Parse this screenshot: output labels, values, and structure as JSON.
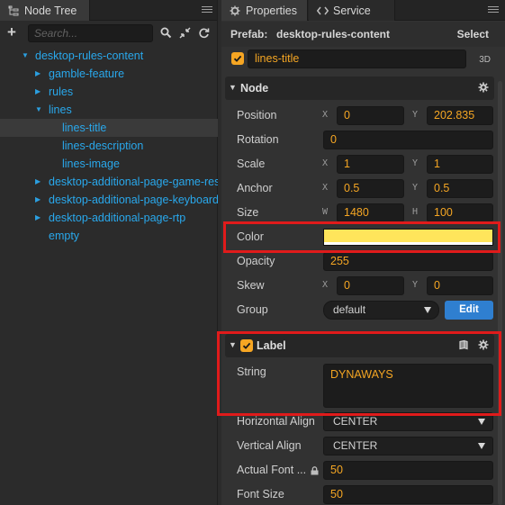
{
  "node_tree": {
    "tab_title": "Node Tree",
    "tab_icon": "tree-icon",
    "search_placeholder": "Search...",
    "nodes": [
      {
        "label": "desktop-rules-content",
        "depth": 0,
        "expanded": true,
        "has_children": true
      },
      {
        "label": "gamble-feature",
        "depth": 1,
        "expanded": false,
        "has_children": true
      },
      {
        "label": "rules",
        "depth": 1,
        "expanded": false,
        "has_children": true
      },
      {
        "label": "lines",
        "depth": 1,
        "expanded": true,
        "has_children": true
      },
      {
        "label": "lines-title",
        "depth": 2,
        "expanded": false,
        "has_children": false,
        "selected": true
      },
      {
        "label": "lines-description",
        "depth": 2,
        "expanded": false,
        "has_children": false
      },
      {
        "label": "lines-image",
        "depth": 2,
        "expanded": false,
        "has_children": false
      },
      {
        "label": "desktop-additional-page-game-resu",
        "depth": 1,
        "expanded": false,
        "has_children": true
      },
      {
        "label": "desktop-additional-page-keyboard",
        "depth": 1,
        "expanded": false,
        "has_children": true
      },
      {
        "label": "desktop-additional-page-rtp",
        "depth": 1,
        "expanded": false,
        "has_children": true
      },
      {
        "label": "empty",
        "depth": 1,
        "expanded": false,
        "has_children": false
      }
    ]
  },
  "properties": {
    "tab_title": "Properties",
    "service_tab": "Service",
    "prefab_label": "Prefab:",
    "prefab_name": "desktop-rules-content",
    "select_label": "Select",
    "node_name": "lines-title",
    "badge_3d": "3D",
    "node_section": {
      "title": "Node",
      "position": {
        "label": "Position",
        "x_axis": "X",
        "x": "0",
        "y_axis": "Y",
        "y": "202.835"
      },
      "rotation": {
        "label": "Rotation",
        "value": "0"
      },
      "scale": {
        "label": "Scale",
        "x_axis": "X",
        "x": "1",
        "y_axis": "Y",
        "y": "1"
      },
      "anchor": {
        "label": "Anchor",
        "x_axis": "X",
        "x": "0.5",
        "y_axis": "Y",
        "y": "0.5"
      },
      "size": {
        "label": "Size",
        "w_axis": "W",
        "w": "1480",
        "h_axis": "H",
        "h": "100"
      },
      "color": {
        "label": "Color",
        "value": "#ffe55b"
      },
      "opacity": {
        "label": "Opacity",
        "value": "255"
      },
      "skew": {
        "label": "Skew",
        "x_axis": "X",
        "x": "0",
        "y_axis": "Y",
        "y": "0"
      },
      "group": {
        "label": "Group",
        "value": "default",
        "edit_label": "Edit"
      }
    },
    "label_section": {
      "title": "Label",
      "string": {
        "label": "String",
        "value": "DYNAWAYS"
      },
      "horizontal_align": {
        "label": "Horizontal Align",
        "value": "CENTER"
      },
      "vertical_align": {
        "label": "Vertical Align",
        "value": "CENTER"
      },
      "actual_font": {
        "label": "Actual Font ...",
        "value": "50"
      },
      "font_size": {
        "label": "Font Size",
        "value": "50"
      }
    }
  },
  "colors": {
    "accent_orange": "#f5a623",
    "tree_blue": "#29a8ec",
    "edit_blue": "#2f7fd0",
    "highlight_red": "#e01b1b",
    "swatch_yellow": "#ffe55b"
  }
}
